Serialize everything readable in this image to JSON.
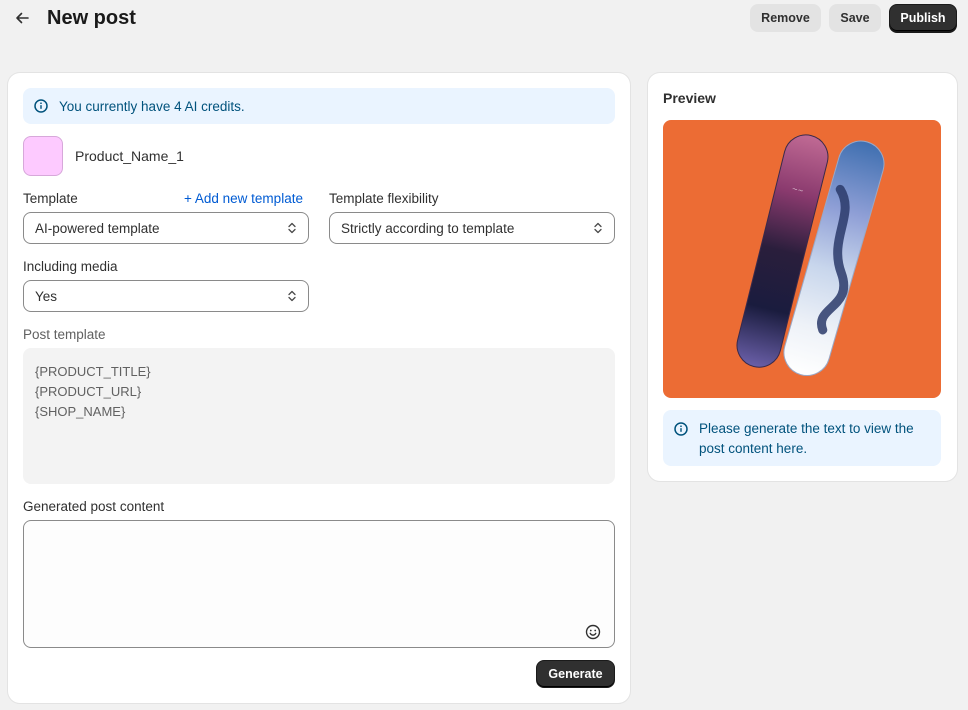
{
  "header": {
    "title": "New post",
    "back_icon": "arrow-left-icon",
    "remove_label": "Remove",
    "save_label": "Save",
    "publish_label": "Publish"
  },
  "banner": {
    "text": "You currently have 4 AI credits.",
    "icon": "info-icon"
  },
  "product": {
    "name": "Product_Name_1",
    "thumb_color": "#fdcaff"
  },
  "template": {
    "label": "Template",
    "add_link": "+ Add new template",
    "value": "AI-powered template"
  },
  "flexibility": {
    "label": "Template flexibility",
    "value": "Strictly according to template"
  },
  "media": {
    "label": "Including media",
    "value": "Yes"
  },
  "post_template": {
    "label": "Post template",
    "lines": [
      "{PRODUCT_TITLE}",
      "{PRODUCT_URL}",
      "{SHOP_NAME}"
    ]
  },
  "generated": {
    "label": "Generated post content",
    "value": "",
    "emoji_icon": "smiley-icon"
  },
  "generate_label": "Generate",
  "preview": {
    "title": "Preview",
    "image_bg": "#ec6c34",
    "note": "Please generate the text to view the post content here."
  },
  "colors": {
    "accent_link": "#005bd3",
    "info_bg": "#eaf4ff",
    "info_text": "#00527c",
    "primary_button": "#303030"
  }
}
